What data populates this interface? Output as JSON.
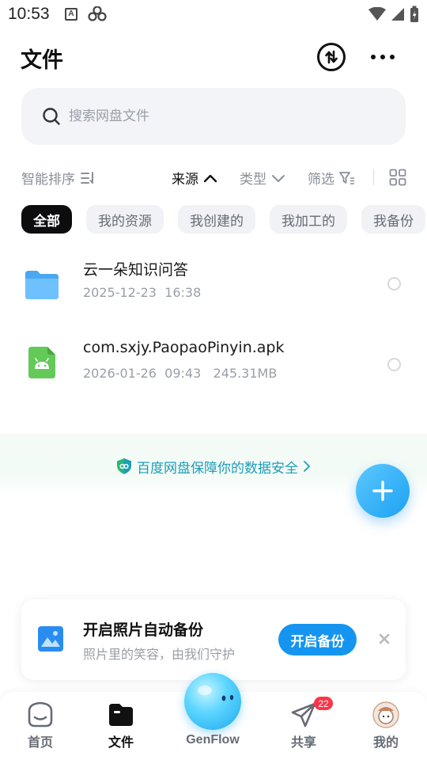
{
  "status_bar": {
    "time": "10:53"
  },
  "header": {
    "title": "文件"
  },
  "search": {
    "placeholder": "搜索网盘文件"
  },
  "sort_row": {
    "sort": "智能排序",
    "source": "来源",
    "type": "类型",
    "filter": "筛选"
  },
  "chips": [
    "全部",
    "我的资源",
    "我创建的",
    "我加工的",
    "我备份"
  ],
  "files": [
    {
      "name": "云一朵知识问答",
      "date": "2025-12-23",
      "time": "16:38",
      "size": "",
      "icon": "folder-icon"
    },
    {
      "name": "com.sxjy.PaopaoPinyin.apk",
      "date": "2026-01-26",
      "time": "09:43",
      "size": "245.31MB",
      "icon": "android-apk-icon"
    }
  ],
  "safety_banner": {
    "text": "百度网盘保障你的数据安全"
  },
  "backup_card": {
    "title": "开启照片自动备份",
    "subtitle": "照片里的笑容，由我们守护",
    "button": "开启备份"
  },
  "bottom_nav": {
    "home": "首页",
    "files": "文件",
    "genflow": "GenFlow",
    "share": "共享",
    "share_badge": "22",
    "mine": "我的"
  },
  "colors": {
    "accent": "#1595f0",
    "badge": "#ff3347",
    "banner_text": "#1f9db8"
  }
}
